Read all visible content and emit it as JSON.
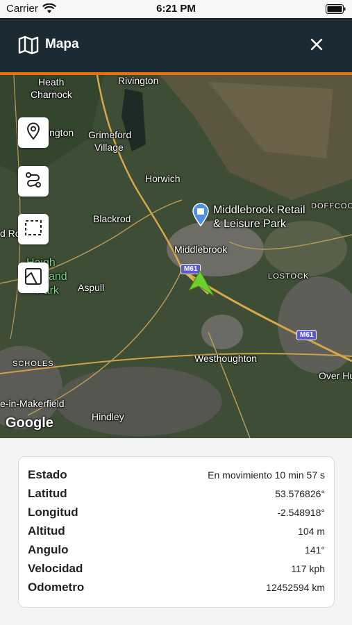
{
  "status_bar": {
    "carrier": "Carrier",
    "time": "6:21 PM"
  },
  "header": {
    "title": "Mapa",
    "icon": "map-icon",
    "close_icon": "close-icon",
    "accent": "#e8730e",
    "background": "#1c2b33"
  },
  "map": {
    "labels": {
      "heath": "Heath",
      "charnock": "Charnock",
      "rivington": "Rivington",
      "ington": "ington",
      "grimeford": "Grimeford",
      "village": "Village",
      "horwich": "Horwich",
      "middlebrook_retail": "Middlebrook Retail",
      "leisure_park": "& Leisure Park",
      "doffcoc": "DOFFCOC",
      "blackrod": "Blackrod",
      "d_ro": "d Ro",
      "middlebrook": "Middlebrook",
      "lostock": "LOSTOCK",
      "haigh": "Haigh",
      "and": "and",
      "park": "Park",
      "aspull": "Aspull",
      "m61_a": "M61",
      "m61_b": "M61",
      "westhoughton": "Westhoughton",
      "scholes": "SCHOLES",
      "over_hu": "Over Hu",
      "makerfield": "e-in-Makerfield",
      "hindley": "Hindley",
      "google": "Google"
    },
    "controls": [
      "location-pin-icon",
      "route-icon",
      "select-area-icon",
      "layers-icon"
    ]
  },
  "info": {
    "rows": [
      {
        "label": "Estado",
        "value": "En movimiento 10 min 57 s"
      },
      {
        "label": "Latitud",
        "value": "53.576826°"
      },
      {
        "label": "Longitud",
        "value": "-2.548918°"
      },
      {
        "label": "Altitud",
        "value": "104 m"
      },
      {
        "label": "Angulo",
        "value": "141°"
      },
      {
        "label": "Velocidad",
        "value": "117 kph"
      },
      {
        "label": "Odometro",
        "value": "12452594 km"
      }
    ]
  }
}
